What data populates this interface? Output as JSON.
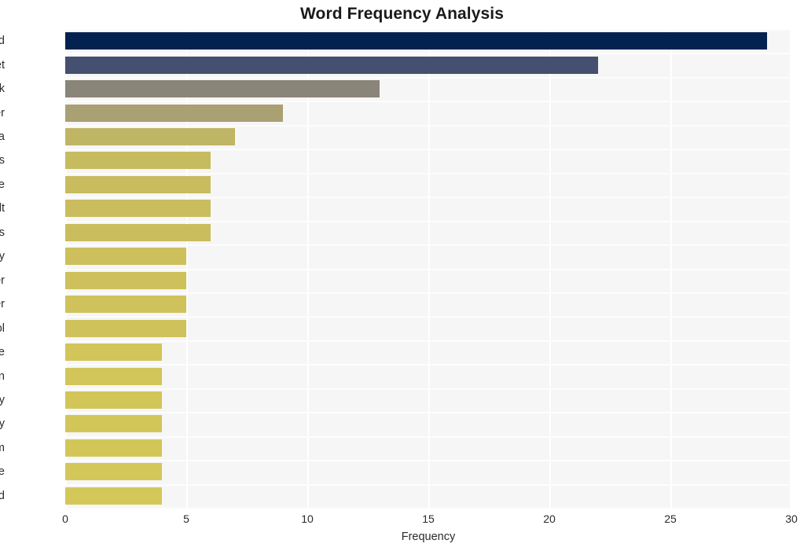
{
  "chart_data": {
    "type": "bar",
    "orientation": "horizontal",
    "title": "Word Frequency Analysis",
    "xlabel": "Frequency",
    "ylabel": "",
    "xlim": [
      0,
      30
    ],
    "xticks": [
      0,
      5,
      10,
      15,
      20,
      25,
      30
    ],
    "xtick_labels": [
      "0",
      "5",
      "10",
      "15",
      "20",
      "25",
      "30"
    ],
    "grid": true,
    "grid_color": "#ffffff",
    "legend": null,
    "plot_background": "#f6f6f6",
    "figure_background": "#ffffff",
    "categories": [
      "brand",
      "market",
      "track",
      "customer",
      "data",
      "insights",
      "time",
      "result",
      "nps",
      "strategy",
      "offer",
      "faster",
      "tool",
      "measure",
      "position",
      "company",
      "survey",
      "team",
      "accurate",
      "build"
    ],
    "values": [
      29,
      22,
      13,
      9,
      7,
      6,
      6,
      6,
      6,
      5,
      5,
      5,
      5,
      4,
      4,
      4,
      4,
      4,
      4,
      4
    ],
    "bar_colors": [
      "#04224f",
      "#454f6f",
      "#8a8579",
      "#a9a074",
      "#c0b565",
      "#c7bb60",
      "#c8bc5f",
      "#c9bd5e",
      "#c9bd5e",
      "#cdc05c",
      "#cec15c",
      "#cfc25b",
      "#cfc25b",
      "#d2c559",
      "#d2c559",
      "#d3c659",
      "#d3c659",
      "#d3c659",
      "#d4c75a",
      "#d4c75a"
    ]
  }
}
